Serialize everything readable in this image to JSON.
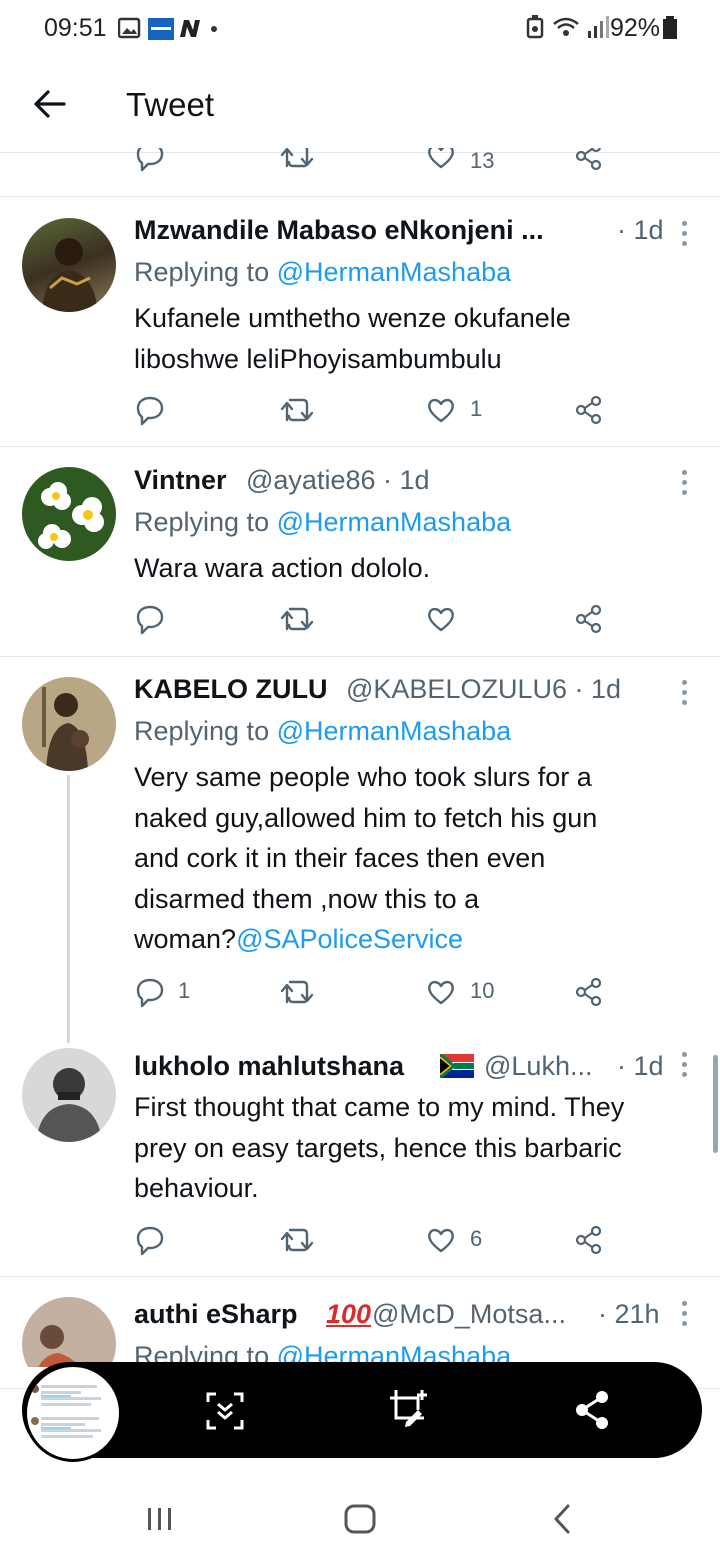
{
  "status_bar": {
    "time": "09:51",
    "battery": "92%"
  },
  "header": {
    "title": "Tweet"
  },
  "top_actions": {
    "likes": "13"
  },
  "tweets": [
    {
      "name": "Mzwandile Mabaso eNkonjeni ...",
      "handle": "",
      "time": "· 1d",
      "replying_prefix": "Replying to",
      "replying_handle": "@HermanMashaba",
      "text_lines": [
        "Kufanele umthetho wenze okufanele",
        "liboshwe leliPhoyisambumbulu"
      ],
      "replies": "",
      "likes": "1"
    },
    {
      "name": "Vintner",
      "handle": "@ayatie86 · 1d",
      "time": "",
      "replying_prefix": "Replying to",
      "replying_handle": "@HermanMashaba",
      "text_lines": [
        "Wara wara action dololo."
      ],
      "replies": "",
      "likes": ""
    },
    {
      "name": "KABELO ZULU",
      "handle": "@KABELOZULU6 · 1d",
      "time": "",
      "replying_prefix": "Replying to",
      "replying_handle": "@HermanMashaba",
      "text_lines": [
        "Very same people who took slurs for a",
        "naked guy,allowed him to fetch his gun",
        "and cork it in their faces then even",
        "disarmed them ,now this to a"
      ],
      "text_last": "woman?",
      "text_link": "@SAPoliceService",
      "replies": "1",
      "likes": "10"
    },
    {
      "name": "lukholo mahlutshana",
      "handle": "@Lukh...",
      "time": "· 1d",
      "text_lines": [
        "First thought that came to my mind. They",
        "prey on easy targets, hence this barbaric",
        "behaviour."
      ],
      "replies": "",
      "likes": "6"
    },
    {
      "name": "authi eSharp",
      "handle": "@McD_Motsa...",
      "time": "· 21h",
      "replying_prefix": "Replying to",
      "replying_handle": "@HermanMashaba"
    }
  ],
  "colors": {
    "accent": "#1d9bf0",
    "secondary_text": "#536471",
    "divider": "#e3e6ea"
  },
  "icons": [
    "back-arrow-icon",
    "reply-icon",
    "retweet-icon",
    "like-icon",
    "share-icon",
    "more-icon",
    "scroll-capture-icon",
    "edit-screenshot-icon",
    "share-screenshot-icon"
  ]
}
